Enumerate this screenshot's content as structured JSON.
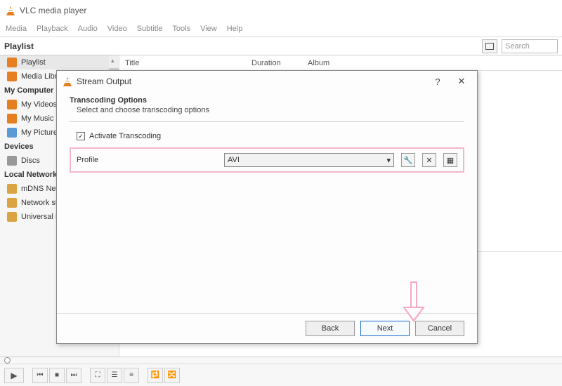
{
  "titlebar": {
    "title": "VLC media player"
  },
  "menu": [
    "Media",
    "Playback",
    "Audio",
    "Video",
    "Subtitle",
    "Tools",
    "View",
    "Help"
  ],
  "toolbar": {
    "playlist_label": "Playlist",
    "search_placeholder": "Search"
  },
  "sidebar": {
    "groups": [
      {
        "label": "",
        "items": [
          {
            "label": "Playlist",
            "selected": true
          },
          {
            "label": "Media Library"
          }
        ]
      },
      {
        "label": "My Computer",
        "items": [
          {
            "label": "My Videos"
          },
          {
            "label": "My Music"
          },
          {
            "label": "My Pictures"
          }
        ]
      },
      {
        "label": "Devices",
        "items": [
          {
            "label": "Discs"
          }
        ]
      },
      {
        "label": "Local Network",
        "items": [
          {
            "label": "mDNS Network"
          },
          {
            "label": "Network streams"
          },
          {
            "label": "Universal Plug'n'Play"
          }
        ]
      }
    ]
  },
  "list": {
    "columns": [
      "Title",
      "Duration",
      "Album"
    ]
  },
  "dialog": {
    "title": "Stream Output",
    "section_title": "Transcoding Options",
    "section_sub": "Select and choose transcoding options",
    "activate_label": "Activate Transcoding",
    "activate_checked": true,
    "profile_label": "Profile",
    "profile_value": "AVI",
    "buttons": {
      "back": "Back",
      "next": "Next",
      "cancel": "Cancel"
    }
  }
}
